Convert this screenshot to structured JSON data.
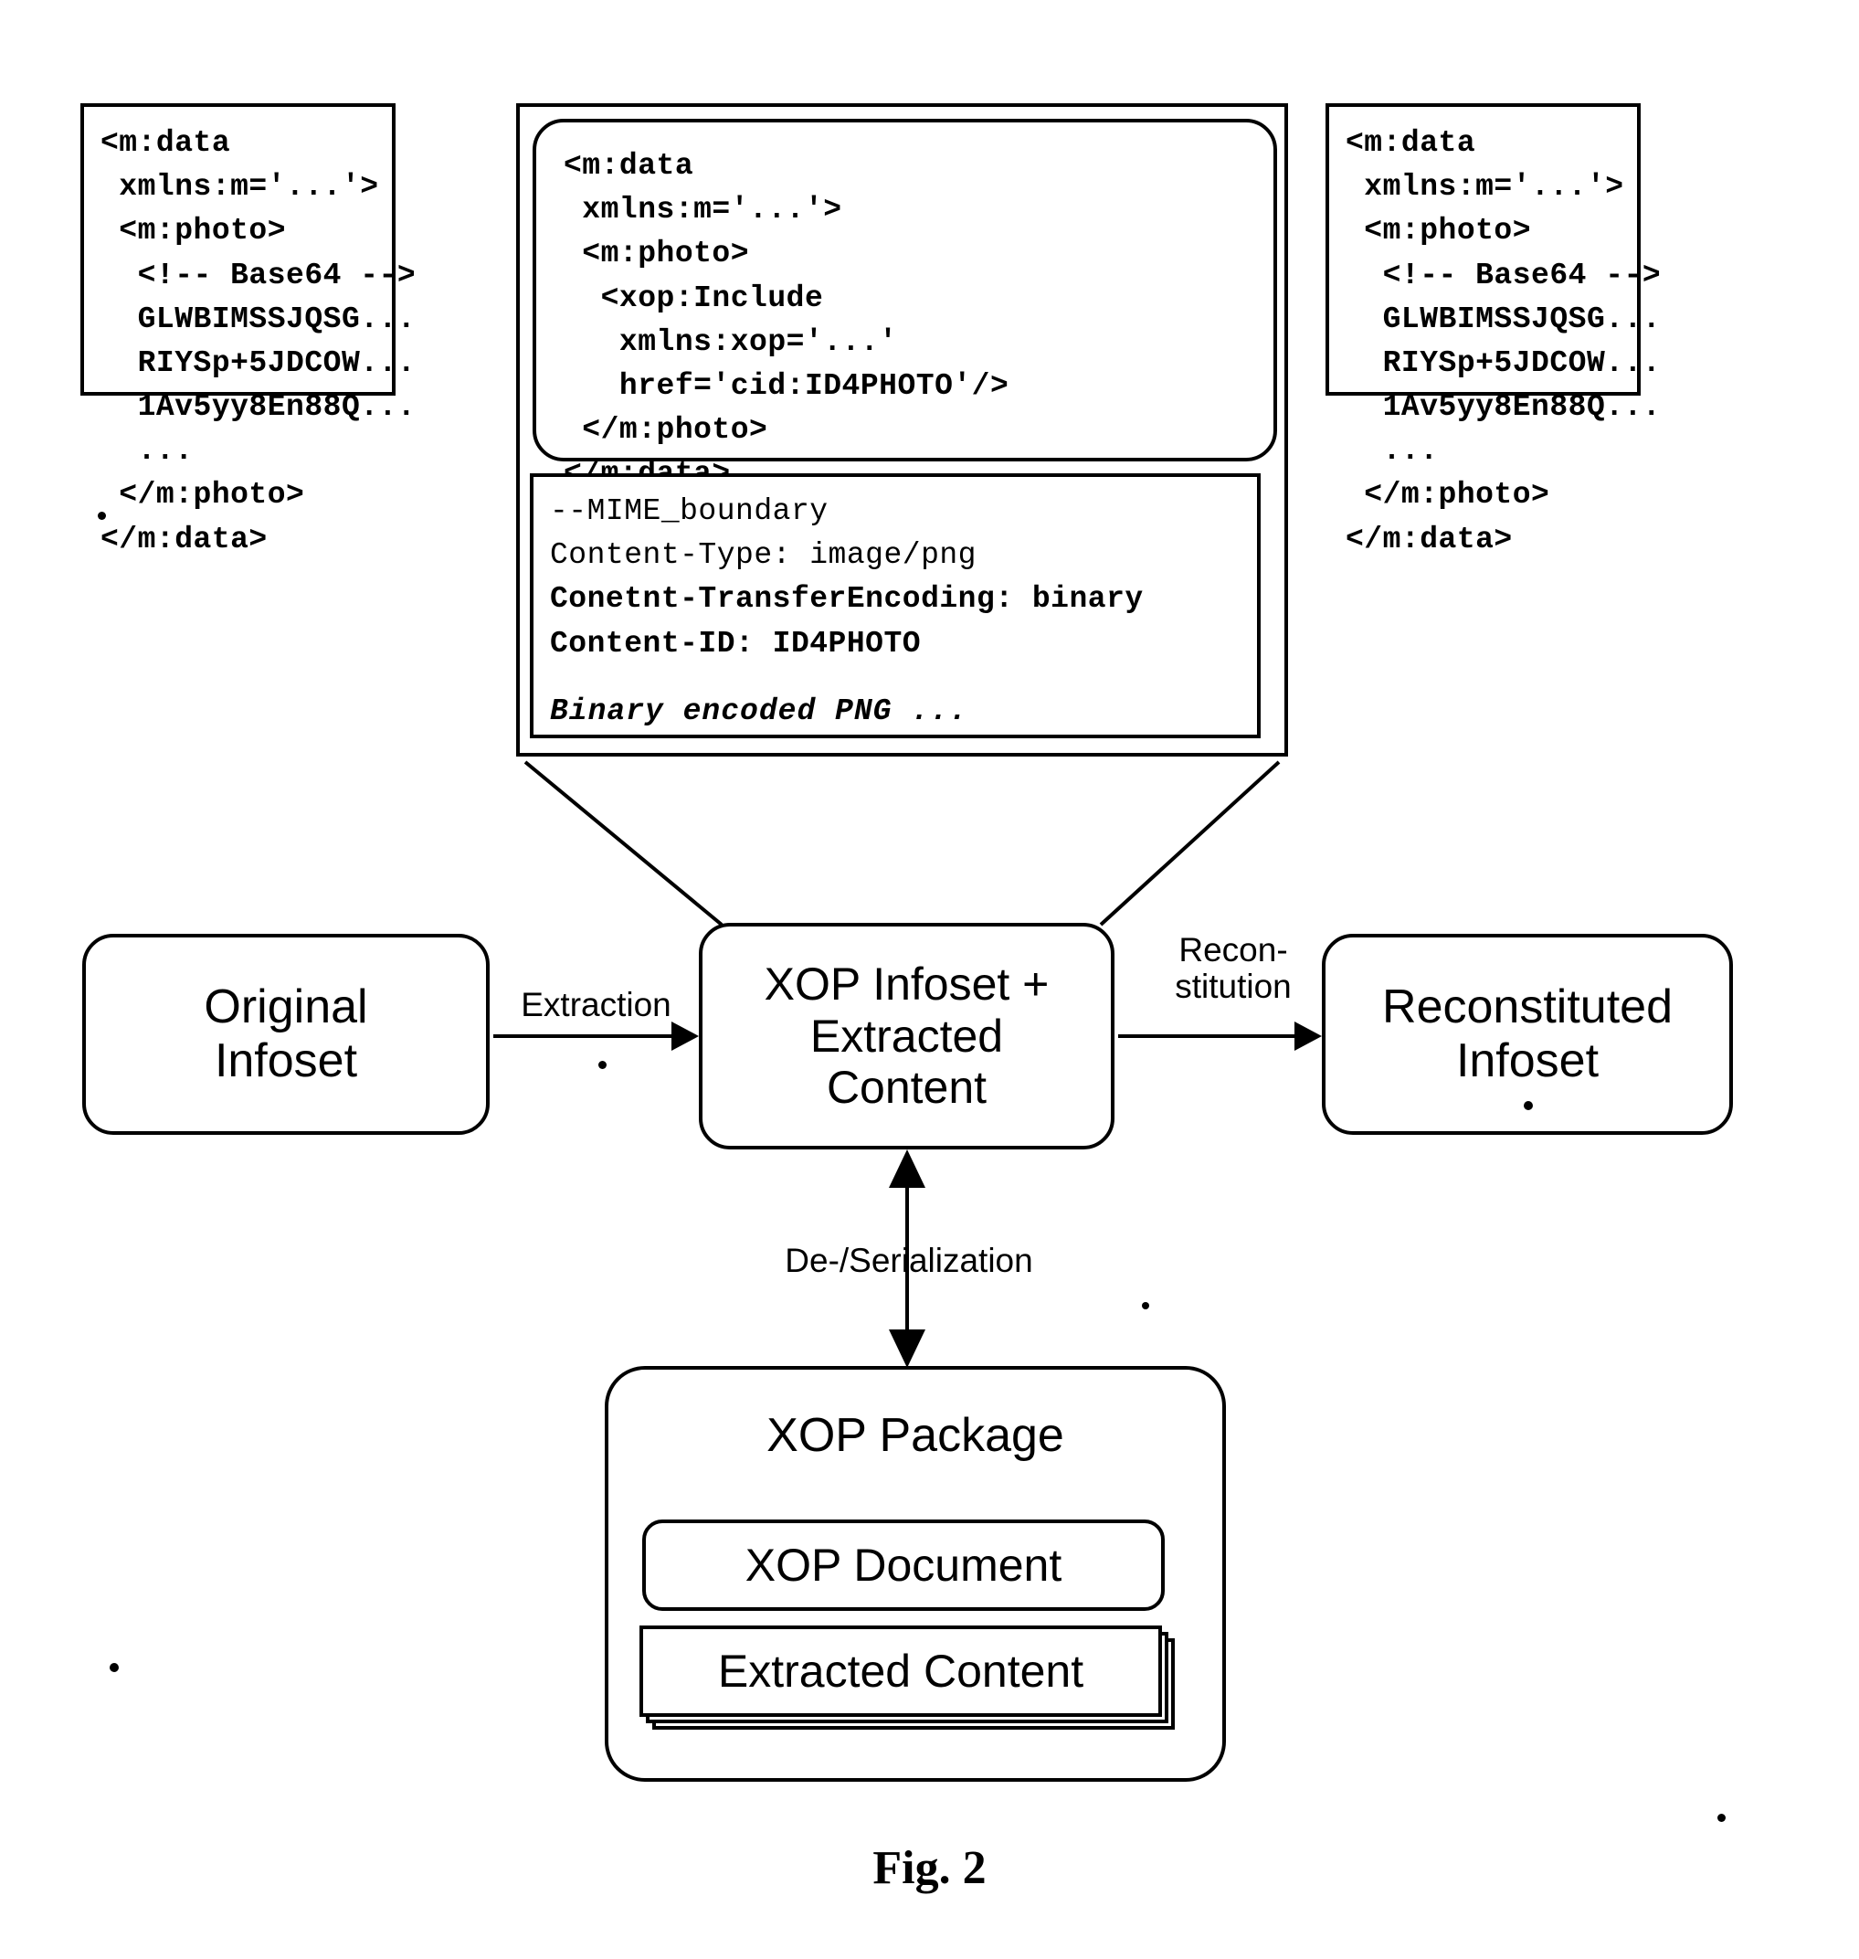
{
  "figure": {
    "caption": "Fig. 2"
  },
  "boxes": {
    "original_infoset_code": {
      "title": "original-infoset-xml",
      "lines": [
        "<m:data",
        " xmlns:m='...'>",
        " <m:photo>",
        "  <!-- Base64 -->",
        "  GLWBIMSSJQSG...",
        "  RIYSp+5JDCOW...",
        "  1Av5yy8En88Q...",
        "  ...",
        " </m:photo>",
        "</m:data>"
      ]
    },
    "reconstituted_infoset_code": {
      "title": "reconstituted-infoset-xml",
      "lines": [
        "<m:data",
        " xmlns:m='...'>",
        " <m:photo>",
        "  <!-- Base64 -->",
        "  GLWBIMSSJQSG...",
        "  RIYSp+5JDCOW...",
        "  1Av5yy8En88Q...",
        "  ...",
        " </m:photo>",
        "</m:data>"
      ]
    },
    "xop_document_code": {
      "title": "xop-infoset-xml",
      "lines": [
        "<m:data",
        " xmlns:m='...'>",
        " <m:photo>",
        "  <xop:Include",
        "   xmlns:xop='...'",
        "   href='cid:ID4PHOTO'/>",
        " </m:photo>",
        "</m:data>"
      ]
    },
    "mime_part": {
      "title": "mime-part",
      "boundary": "--MIME_boundary",
      "content_type": "Content-Type: image/png",
      "transfer_encoding": "Conetnt-TransferEncoding: binary",
      "content_id": "Content-ID: ID4PHOTO",
      "body": "Binary encoded PNG ..."
    }
  },
  "nodes": {
    "original_infoset": {
      "line1": "Original",
      "line2": "Infoset"
    },
    "xop_infoset": {
      "line1": "XOP Infoset +",
      "line2": "Extracted",
      "line3": "Content"
    },
    "reconstituted_infoset": {
      "line1": "Reconstituted",
      "line2": "Infoset"
    },
    "xop_package": {
      "title": "XOP Package",
      "xop_document": "XOP Document",
      "extracted_content": "Extracted Content"
    }
  },
  "arrows": {
    "extraction": "Extraction",
    "reconstitution_line1": "Recon-",
    "reconstitution_line2": "stitution",
    "deserialization": "De-/Serialization"
  },
  "colors": {
    "stroke": "#000000",
    "background": "#ffffff"
  }
}
